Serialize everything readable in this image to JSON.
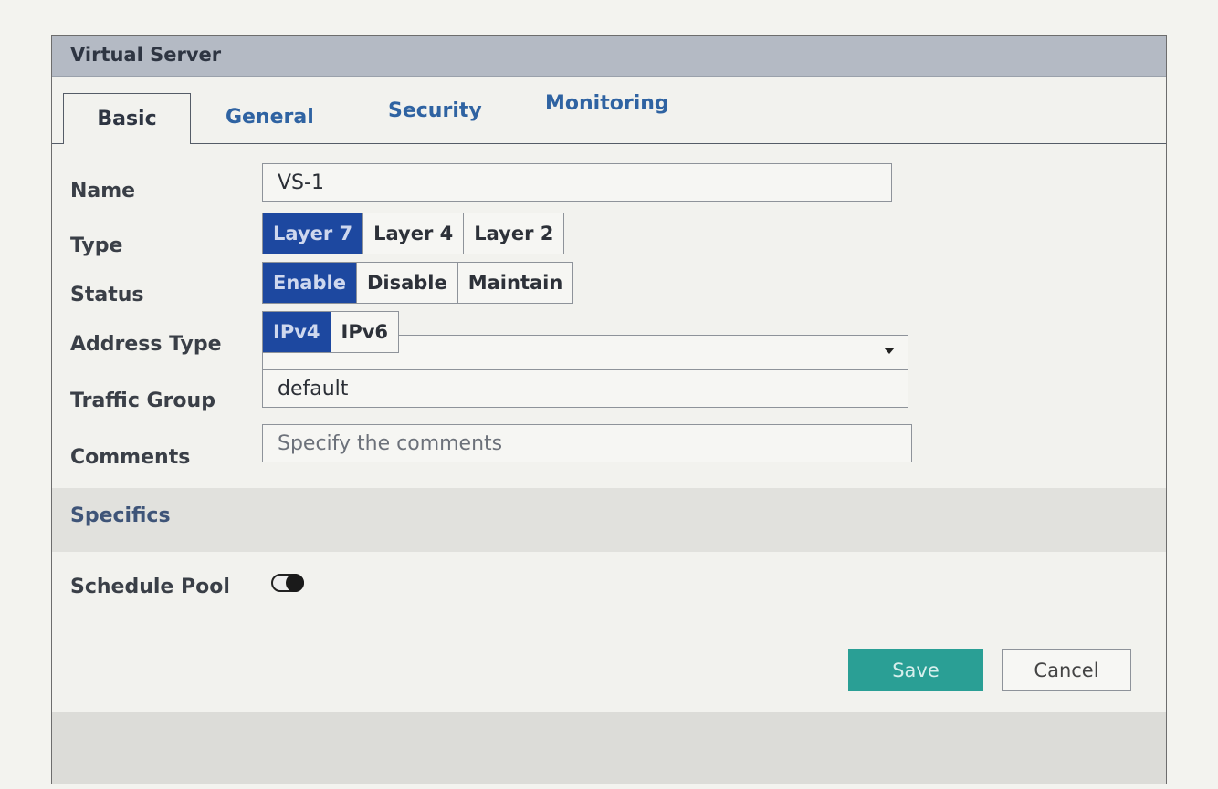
{
  "dialog": {
    "title": "Virtual Server",
    "tabs": [
      {
        "label": "Basic",
        "active": true
      },
      {
        "label": "General",
        "active": false
      },
      {
        "label": "Security",
        "active": false
      },
      {
        "label": "Monitoring",
        "active": false
      }
    ]
  },
  "form": {
    "name": {
      "label": "Name",
      "value": "VS-1"
    },
    "type": {
      "label": "Type",
      "options": [
        "Layer 7",
        "Layer 4",
        "Layer 2"
      ],
      "selected": "Layer 7"
    },
    "status": {
      "label": "Status",
      "options": [
        "Enable",
        "Disable",
        "Maintain"
      ],
      "selected": "Enable"
    },
    "address_type": {
      "label": "Address Type",
      "options": [
        "IPv4",
        "IPv6"
      ],
      "selected": "IPv4"
    },
    "traffic_group": {
      "label": "Traffic Group",
      "value": "default"
    },
    "comments": {
      "label": "Comments",
      "value": "",
      "placeholder": "Specify the comments"
    }
  },
  "specifics": {
    "heading": "Specifics",
    "schedule_pool": {
      "label": "Schedule Pool",
      "enabled": false
    }
  },
  "buttons": {
    "save": "Save",
    "cancel": "Cancel"
  },
  "colors": {
    "selected": "#1d48a0",
    "save": "#2a9f95",
    "titlebar": "#b4bac4",
    "tab_link": "#2f63a2"
  },
  "icons": {
    "dropdown": "chevron-down-icon",
    "toggle": "toggle-switch-icon"
  }
}
